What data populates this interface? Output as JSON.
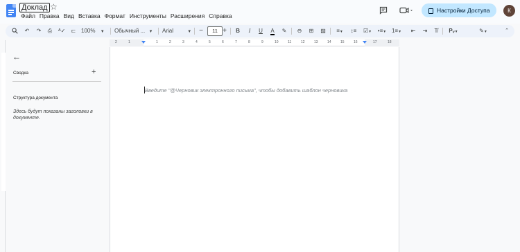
{
  "header": {
    "doc_title": "Доклад",
    "menu": [
      "Файл",
      "Правка",
      "Вид",
      "Вставка",
      "Формат",
      "Инструменты",
      "Расширения",
      "Справка"
    ],
    "share_label": "Настройки Доступа",
    "avatar_initial": "К"
  },
  "toolbar": {
    "zoom": "100%",
    "style": "Обычный ...",
    "font": "Arial",
    "font_size": "11"
  },
  "ruler": {
    "numbers": [
      "2",
      "1",
      "1",
      "2",
      "3",
      "4",
      "5",
      "6",
      "7",
      "8",
      "9",
      "10",
      "11",
      "12",
      "13",
      "14",
      "15",
      "16",
      "17",
      "18"
    ]
  },
  "sidebar": {
    "summary_label": "Сводка",
    "outline_label": "Структура документа",
    "outline_hint": "Здесь будут показаны заголовки в документе."
  },
  "document": {
    "placeholder": "Введите \"@Черновик электронного письма\", чтобы добавить шаблон черновика"
  },
  "colors": {
    "share_button": "#c2e7ff",
    "toolbar_bg": "#edf2fa",
    "docs_blue": "#4285f4"
  }
}
